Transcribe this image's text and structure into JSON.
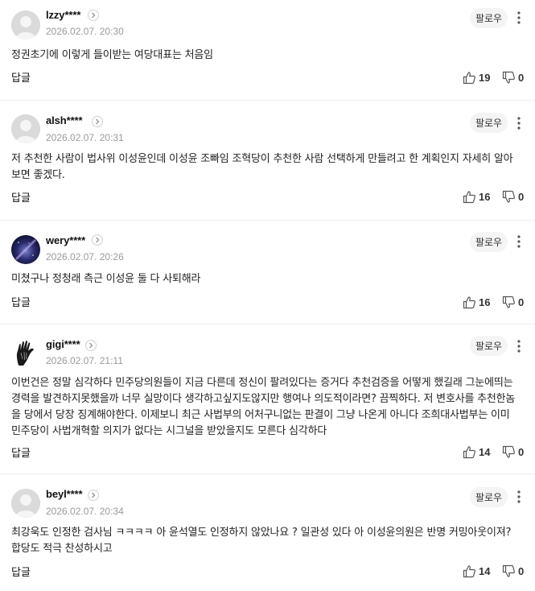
{
  "comments": [
    {
      "username": "lzzy****",
      "timestamp": "2026.02.07. 20:30",
      "follow_label": "팔로우",
      "text": "정권초기에 이렇게 들이받는 여당대표는 처음임",
      "reply_label": "답글",
      "likes": "19",
      "dislikes": "0",
      "avatar": "default"
    },
    {
      "username": "alsh****",
      "timestamp": "2026.02.07. 20:31",
      "follow_label": "팔로우",
      "text": "저 추천한 사람이 법사위 이성윤인데 이성윤 조빠임 조혁당이 추천한 사람 선택하게 만들려고 한 계획인지 자세히 알아보면 좋겠다.",
      "reply_label": "답글",
      "likes": "16",
      "dislikes": "0",
      "avatar": "default"
    },
    {
      "username": "wery****",
      "timestamp": "2026.02.07. 20:26",
      "follow_label": "팔로우",
      "text": "미쳤구나 정청래 측근 이성윤 둘 다 사퇴해라",
      "reply_label": "답글",
      "likes": "16",
      "dislikes": "0",
      "avatar": "galaxy"
    },
    {
      "username": "gigi****",
      "timestamp": "2026.02.07. 21:11",
      "follow_label": "팔로우",
      "text": "이번건은 정말 심각하다 민주당의원들이 지금 다른데 정신이 팔려있다는 증거다 추천검증을 어떻게 했길래 그눈에띄는 경력을 발견하지못했을까 너무 실망이다 생각하고싶지도않지만 행여나 의도적이라면? 끔찍하다. 저 변호사를 추천한놈을 당에서 당장 징계해야한다. 이제보니 최근 사법부의 어처구니없는 판결이 그냥 나온게 아니다 조희대사법부는 이미 민주당이 사법개혁할 의지가 없다는 시그널을 받았을지도 모른다 심각하다",
      "reply_label": "답글",
      "likes": "14",
      "dislikes": "0",
      "avatar": "hand"
    },
    {
      "username": "beyl****",
      "timestamp": "2026.02.07. 20:34",
      "follow_label": "팔로우",
      "text": "최강욱도 인정한 검사님 ㅋㅋㅋㅋ 아 윤석열도 인정하지 않았나요 ? 일관성 있다 아 이성윤의원은 반명 커밍아웃이져? 합당도 적극 찬성하시고",
      "reply_label": "답글",
      "likes": "14",
      "dislikes": "0",
      "avatar": "default"
    }
  ]
}
